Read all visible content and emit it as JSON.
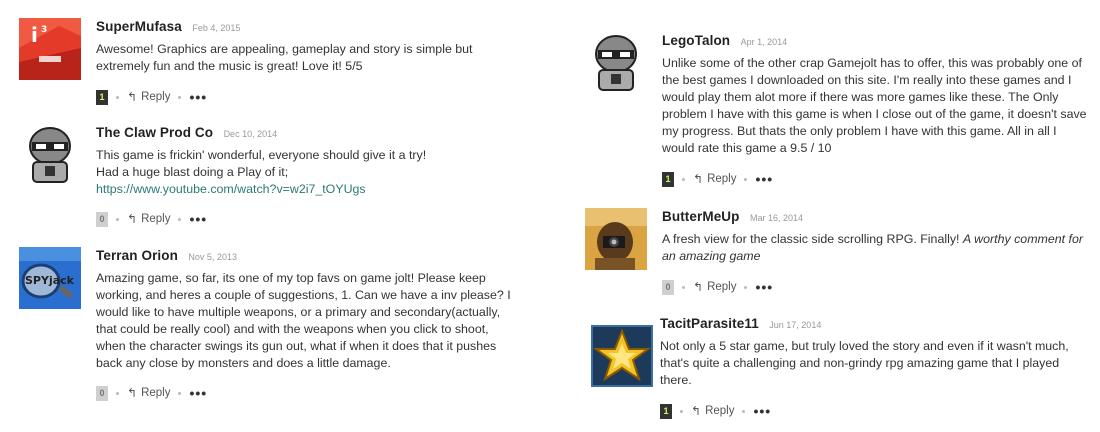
{
  "comments": [
    {
      "author": "SuperMufasa",
      "date": "Feb 4, 2015",
      "text": "Awesome! Graphics are appealing, gameplay and story is simple but extremely fun and the music is great! Love it! 5/5",
      "votes": "1",
      "reply_label": "Reply",
      "more": "•••"
    },
    {
      "author": "The Claw Prod Co",
      "date": "Dec 10, 2014",
      "line1": "This game is frickin' wonderful, everyone should give it a try!",
      "line2": "Had a huge blast doing a Play of it;",
      "link": "https://www.youtube.com/watch?v=w2i7_tOYUgs",
      "votes": "0",
      "reply_label": "Reply",
      "more": "•••"
    },
    {
      "author": "Terran Orion",
      "date": "Nov 5, 2013",
      "text": "Amazing game, so far, its one of my top favs on game jolt! Please keep working, and heres a couple of suggestions, 1. Can we have a inv please? I would like to have multiple weapons, or a primary and secondary(actually, that could be really cool) and with the weapons when you click to shoot, when the character swings its gun out, what if when it does that it pushes back any close by monsters and does a little damage.",
      "avatar_text": "SPYjack",
      "votes": "0",
      "reply_label": "Reply",
      "more": "•••"
    },
    {
      "author": "LegoTalon",
      "date": "Apr 1, 2014",
      "text": "Unlike some of the other crap Gamejolt has to offer, this was probably one of the best games I downloaded on this site. I'm really into these games and I would play them alot more if there was more games like these. The Only problem I have with this game is when I close out of the game, it doesn't save my progress. But thats the only problem I have with this game. All in all I would rate this game a 9.5 / 10",
      "votes": "1",
      "reply_label": "Reply",
      "more": "•••"
    },
    {
      "author": "ButterMeUp",
      "date": "Mar 16, 2014",
      "text": "A fresh view for the classic side scrolling RPG. Finally! ",
      "text_italic": "A worthy comment for an amazing game",
      "votes": "0",
      "reply_label": "Reply",
      "more": "•••"
    },
    {
      "author": "TacitParasite11",
      "date": "Jun 17, 2014",
      "text": "Not only a 5 star game, but truly loved the story and even if it wasn't much, that's quite a challenging and non-grindy rpg amazing game that I played there.",
      "votes": "1",
      "reply_label": "Reply",
      "more": "•••"
    }
  ]
}
